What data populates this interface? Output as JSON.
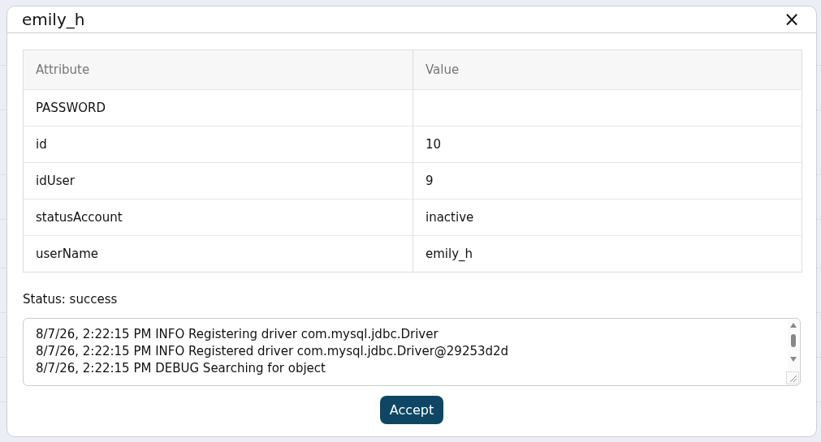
{
  "dialog": {
    "title": "emily_h",
    "close": "×"
  },
  "table": {
    "columns": [
      "Attribute",
      "Value"
    ],
    "rows": [
      {
        "attribute": "PASSWORD",
        "value": ""
      },
      {
        "attribute": "id",
        "value": "10"
      },
      {
        "attribute": "idUser",
        "value": "9"
      },
      {
        "attribute": "statusAccount",
        "value": "inactive"
      },
      {
        "attribute": "userName",
        "value": "emily_h"
      }
    ]
  },
  "status": "Status: success",
  "log": [
    "8/7/26, 2:22:15 PM INFO Registering driver com.mysql.jdbc.Driver",
    "8/7/26, 2:22:15 PM INFO Registered driver com.mysql.jdbc.Driver@29253d2d",
    "8/7/26, 2:22:15 PM DEBUG Searching for object"
  ],
  "accept": "Accept"
}
